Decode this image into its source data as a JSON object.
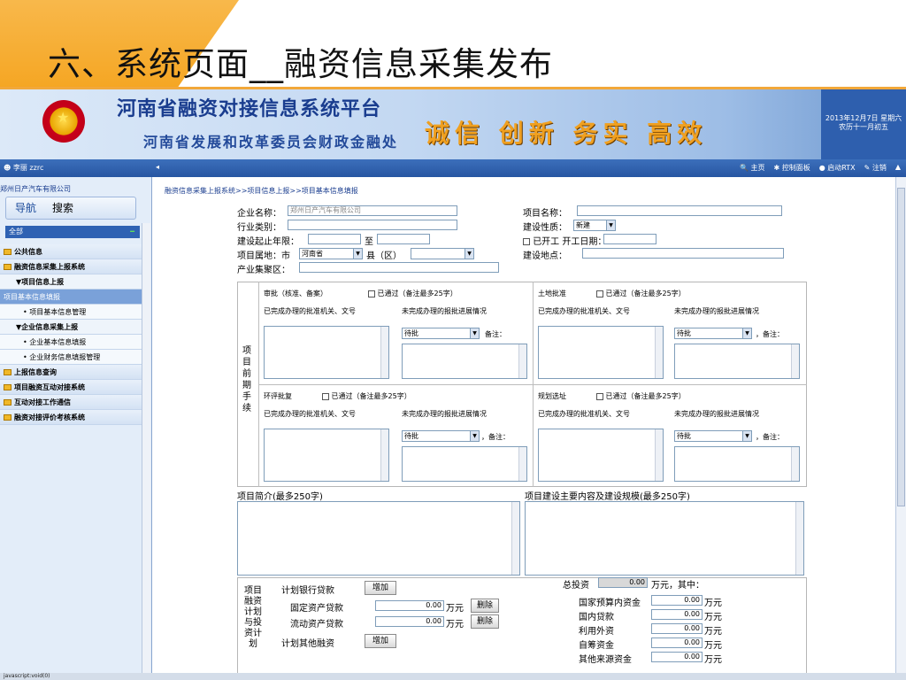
{
  "slide": {
    "title": "六、系统页面__融资信息采集发布"
  },
  "banner": {
    "main_title": "河南省融资对接信息系统平台",
    "sub_title": "河南省发展和改革委员会财政金融处",
    "slogan": "诚信 创新 务实 高效",
    "date_line1": "2013年12月7日 星期六",
    "date_line2": "农历十一月初五"
  },
  "toolbar": {
    "user": "李丽  zzrc",
    "home": "主页",
    "control_panel": "控制面板",
    "rtx": "启动RTX",
    "logout": "注销"
  },
  "sidebar": {
    "company": "郑州日产汽车有限公司",
    "tab_nav": "导航",
    "tab_search": "搜索",
    "all_label": "全部",
    "items": [
      {
        "label": "公共信息",
        "kind": "section"
      },
      {
        "label": "融资信息采集上报系统",
        "kind": "section"
      },
      {
        "label": "▼项目信息上报",
        "kind": "sub"
      },
      {
        "label": "项目基本信息填报",
        "kind": "active"
      },
      {
        "label": "• 项目基本信息管理",
        "kind": "leaf"
      },
      {
        "label": "▼企业信息采集上报",
        "kind": "sub"
      },
      {
        "label": "• 企业基本信息填报",
        "kind": "leaf"
      },
      {
        "label": "• 企业财务信息填报管理",
        "kind": "leaf"
      },
      {
        "label": "上报信息查询",
        "kind": "section"
      },
      {
        "label": "项目融资互动对接系统",
        "kind": "section"
      },
      {
        "label": "互动对接工作通信",
        "kind": "section"
      },
      {
        "label": "融资对接评价考核系统",
        "kind": "section"
      }
    ]
  },
  "breadcrumb": "融资信息采集上报系统>>项目信息上报>>项目基本信息填报",
  "form": {
    "company_label": "企业名称：",
    "company_value": "郑州日产汽车有限公司",
    "project_name_label": "项目名称：",
    "industry_label": "行业类别：",
    "nature_label": "建设性质：",
    "nature_value": "新建",
    "period_label": "建设起止年限：",
    "to_label": "至",
    "started_label": "已开工 开工日期：",
    "location_label": "项目属地：市",
    "province_value": "河南省",
    "county_label": "县（区）",
    "site_label": "建设地点：",
    "cluster_label": "产业集聚区：",
    "pre_label": "项目前期手续",
    "approval_title": "审批（核准、备案）",
    "approval_passed": "已通过（备注最多25字）",
    "land_title": "土地批准",
    "land_passed": "已通过（备注最多25字）",
    "env_title": "环评批复",
    "env_passed": "已通过（备注最多25字）",
    "plan_title": "规划选址",
    "plan_passed": "已通过（备注最多25字）",
    "col_done": "已完成办理的批准机关、文号",
    "col_pending": "未完成办理的报批进展情况",
    "pending_value": "待批",
    "remark_label": "备注：",
    "remark_label2": "，备注：",
    "intro_label": "项目简介(最多250字)",
    "scope_label": "项目建设主要内容及建设规模(最多250字)",
    "finance_side": "项目融资计划与投资计划",
    "bank_loan_label": "计划银行贷款",
    "add_button": "增加",
    "fixed_loan_label": "固定资产贷款",
    "working_loan_label": "流动资产贷款",
    "amount_zero": "0.00",
    "unit_wan": "万元",
    "delete_button": "删除",
    "other_finance_label": "计划其他融资",
    "total_label": "总投资",
    "total_value": "0.00",
    "total_suffix": "万元，其中：",
    "budget_label": "国家预算内资金",
    "domestic_loan_label": "国内贷款",
    "foreign_label": "利用外资",
    "self_label": "自筹资金",
    "other_source_label": "其他来源资金"
  },
  "statusbar": "javascript:void(0)"
}
